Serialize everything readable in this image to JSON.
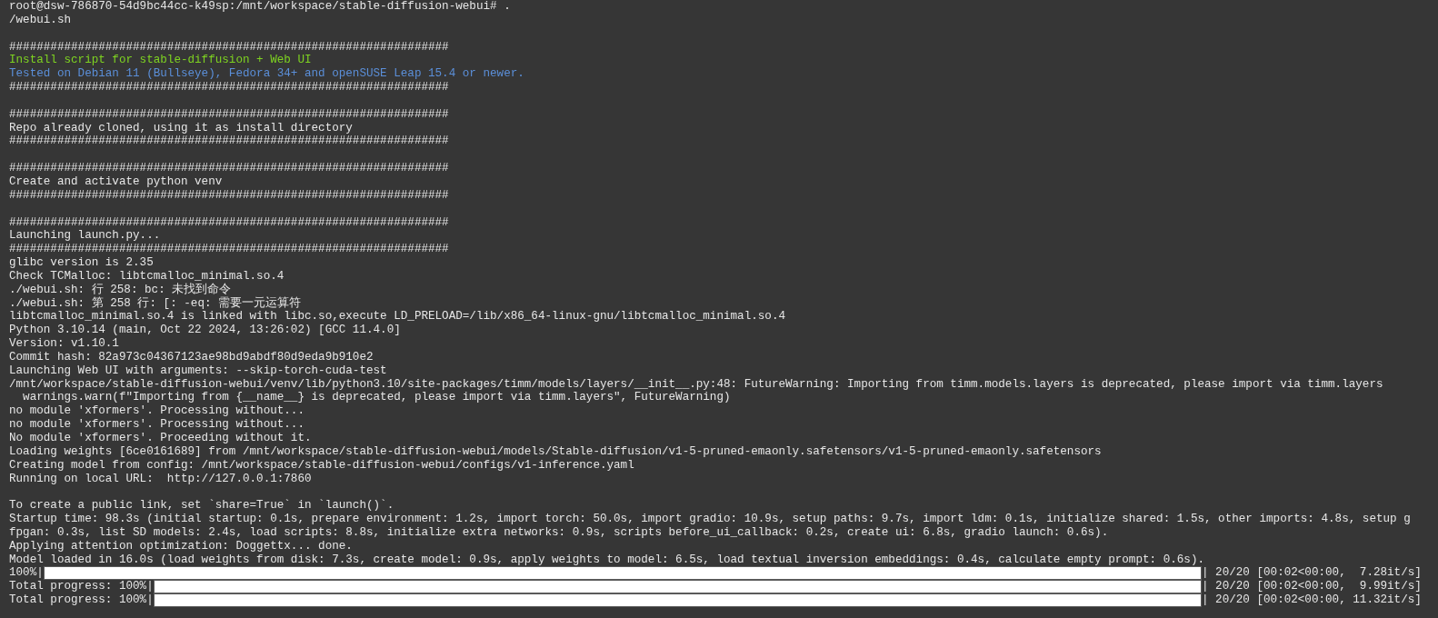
{
  "terminal": {
    "lines": [
      {
        "kind": "text",
        "text": "root@dsw-786870-54d9bc44cc-k49sp:/mnt/workspace/stable-diffusion-webui# ."
      },
      {
        "kind": "text",
        "text": "/webui.sh"
      },
      {
        "kind": "blank"
      },
      {
        "kind": "text",
        "text": "################################################################"
      },
      {
        "kind": "green",
        "text": "Install script for stable-diffusion + Web UI"
      },
      {
        "kind": "blue",
        "text": "Tested on Debian 11 (Bullseye), Fedora 34+ and openSUSE Leap 15.4 or newer."
      },
      {
        "kind": "text",
        "text": "################################################################"
      },
      {
        "kind": "blank"
      },
      {
        "kind": "text",
        "text": "################################################################"
      },
      {
        "kind": "text",
        "text": "Repo already cloned, using it as install directory"
      },
      {
        "kind": "text",
        "text": "################################################################"
      },
      {
        "kind": "blank"
      },
      {
        "kind": "text",
        "text": "################################################################"
      },
      {
        "kind": "text",
        "text": "Create and activate python venv"
      },
      {
        "kind": "text",
        "text": "################################################################"
      },
      {
        "kind": "blank"
      },
      {
        "kind": "text",
        "text": "################################################################"
      },
      {
        "kind": "text",
        "text": "Launching launch.py..."
      },
      {
        "kind": "text",
        "text": "################################################################"
      },
      {
        "kind": "text",
        "text": "glibc version is 2.35"
      },
      {
        "kind": "text",
        "text": "Check TCMalloc: libtcmalloc_minimal.so.4"
      },
      {
        "kind": "text",
        "text": "./webui.sh: 行 258: bc: 未找到命令"
      },
      {
        "kind": "text",
        "text": "./webui.sh: 第 258 行: [: -eq: 需要一元运算符"
      },
      {
        "kind": "text",
        "text": "libtcmalloc_minimal.so.4 is linked with libc.so,execute LD_PRELOAD=/lib/x86_64-linux-gnu/libtcmalloc_minimal.so.4"
      },
      {
        "kind": "text",
        "text": "Python 3.10.14 (main, Oct 22 2024, 13:26:02) [GCC 11.4.0]"
      },
      {
        "kind": "text",
        "text": "Version: v1.10.1"
      },
      {
        "kind": "text",
        "text": "Commit hash: 82a973c04367123ae98bd9abdf80d9eda9b910e2"
      },
      {
        "kind": "text",
        "text": "Launching Web UI with arguments: --skip-torch-cuda-test"
      },
      {
        "kind": "text",
        "text": "/mnt/workspace/stable-diffusion-webui/venv/lib/python3.10/site-packages/timm/models/layers/__init__.py:48: FutureWarning: Importing from timm.models.layers is deprecated, please import via timm.layers"
      },
      {
        "kind": "text",
        "text": "  warnings.warn(f\"Importing from {__name__} is deprecated, please import via timm.layers\", FutureWarning)"
      },
      {
        "kind": "text",
        "text": "no module 'xformers'. Processing without..."
      },
      {
        "kind": "text",
        "text": "no module 'xformers'. Processing without..."
      },
      {
        "kind": "text",
        "text": "No module 'xformers'. Proceeding without it."
      },
      {
        "kind": "text",
        "text": "Loading weights [6ce0161689] from /mnt/workspace/stable-diffusion-webui/models/Stable-diffusion/v1-5-pruned-emaonly.safetensors/v1-5-pruned-emaonly.safetensors"
      },
      {
        "kind": "text",
        "text": "Creating model from config: /mnt/workspace/stable-diffusion-webui/configs/v1-inference.yaml"
      },
      {
        "kind": "text",
        "text": "Running on local URL:  http://127.0.0.1:7860"
      },
      {
        "kind": "blank"
      },
      {
        "kind": "text",
        "text": "To create a public link, set `share=True` in `launch()`."
      },
      {
        "kind": "text",
        "text": "Startup time: 98.3s (initial startup: 0.1s, prepare environment: 1.2s, import torch: 50.0s, import gradio: 10.9s, setup paths: 9.7s, import ldm: 0.1s, initialize shared: 1.5s, other imports: 4.8s, setup g"
      },
      {
        "kind": "text",
        "text": "fpgan: 0.3s, list SD models: 2.4s, load scripts: 8.8s, initialize extra networks: 0.9s, scripts before_ui_callback: 0.2s, create ui: 6.8s, gradio launch: 0.6s)."
      },
      {
        "kind": "text",
        "text": "Applying attention optimization: Doggettx... done."
      },
      {
        "kind": "text",
        "text": "Model loaded in 16.0s (load weights from disk: 7.3s, create model: 0.9s, apply weights to model: 6.5s, load textual inversion embeddings: 0.4s, calculate empty prompt: 0.6s)."
      },
      {
        "kind": "progress",
        "text": "100%|",
        "level": 1.0,
        "suffix": "| 20/20 [00:02<00:00,  7.28it/s]"
      },
      {
        "kind": "progress",
        "text": "Total progress: 100%|",
        "level": 1.0,
        "suffix": "| 20/20 [00:02<00:00,  9.99it/s]"
      },
      {
        "kind": "progress",
        "text": "Total progress: 100%|",
        "level": 1.0,
        "suffix": "| 20/20 [00:02<00:00, 11.32it/s]"
      }
    ]
  }
}
